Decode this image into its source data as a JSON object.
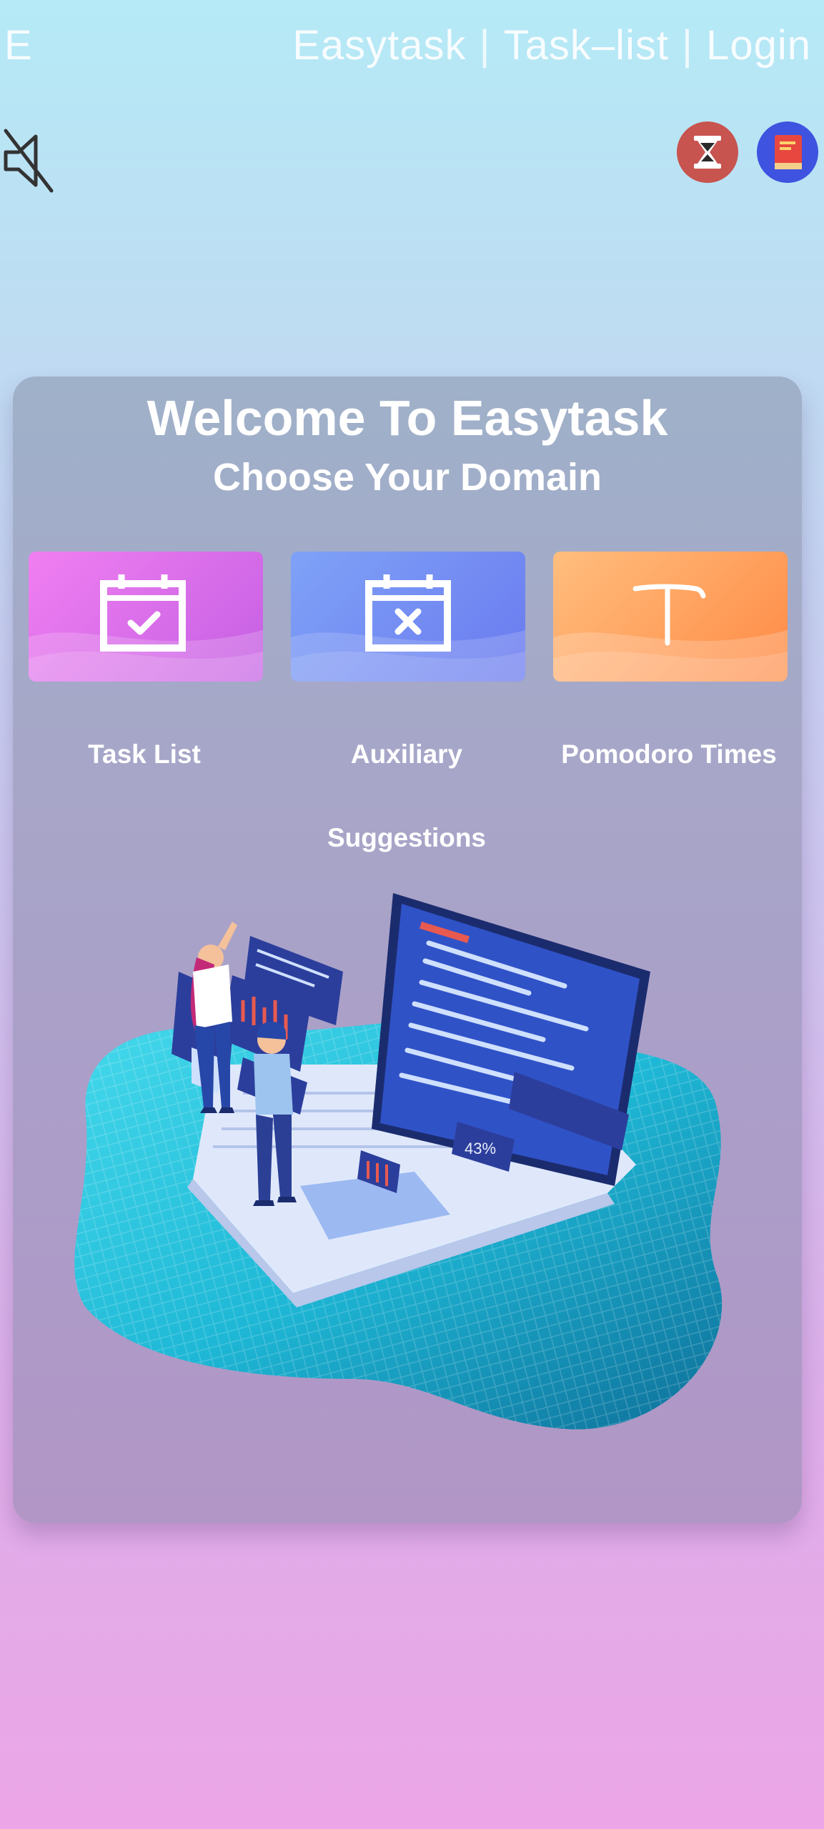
{
  "header": {
    "brand_letter": "E",
    "nav": {
      "easytask": "Easytask",
      "task_list": "Task–list",
      "login": "Login",
      "separator": "|"
    }
  },
  "toolbar": {
    "mute_icon": "speaker-muted-icon",
    "timer_icon": "hourglass-icon",
    "book_icon": "book-icon"
  },
  "welcome": {
    "title": "Welcome To Easytask",
    "subtitle": "Choose Your Domain"
  },
  "domains": [
    {
      "label": "Task List",
      "icon": "calendar-check-icon",
      "color_from": "#f17ff1",
      "color_to": "#c45fe3"
    },
    {
      "label": "Auxiliary",
      "label_line2": "Suggestions",
      "icon": "calendar-x-icon",
      "color_from": "#7fa2f7",
      "color_to": "#6a7aef"
    },
    {
      "label": "Pomodoro Times",
      "icon": "t-letter-icon",
      "color_from": "#ffbe7e",
      "color_to": "#ff8a45"
    }
  ],
  "illustration": {
    "icon": "laptop-teamwork-illustration",
    "screen_badge": "43%"
  },
  "colors": {
    "timer_button": "#c8544f",
    "book_button": "#3e53e0"
  }
}
